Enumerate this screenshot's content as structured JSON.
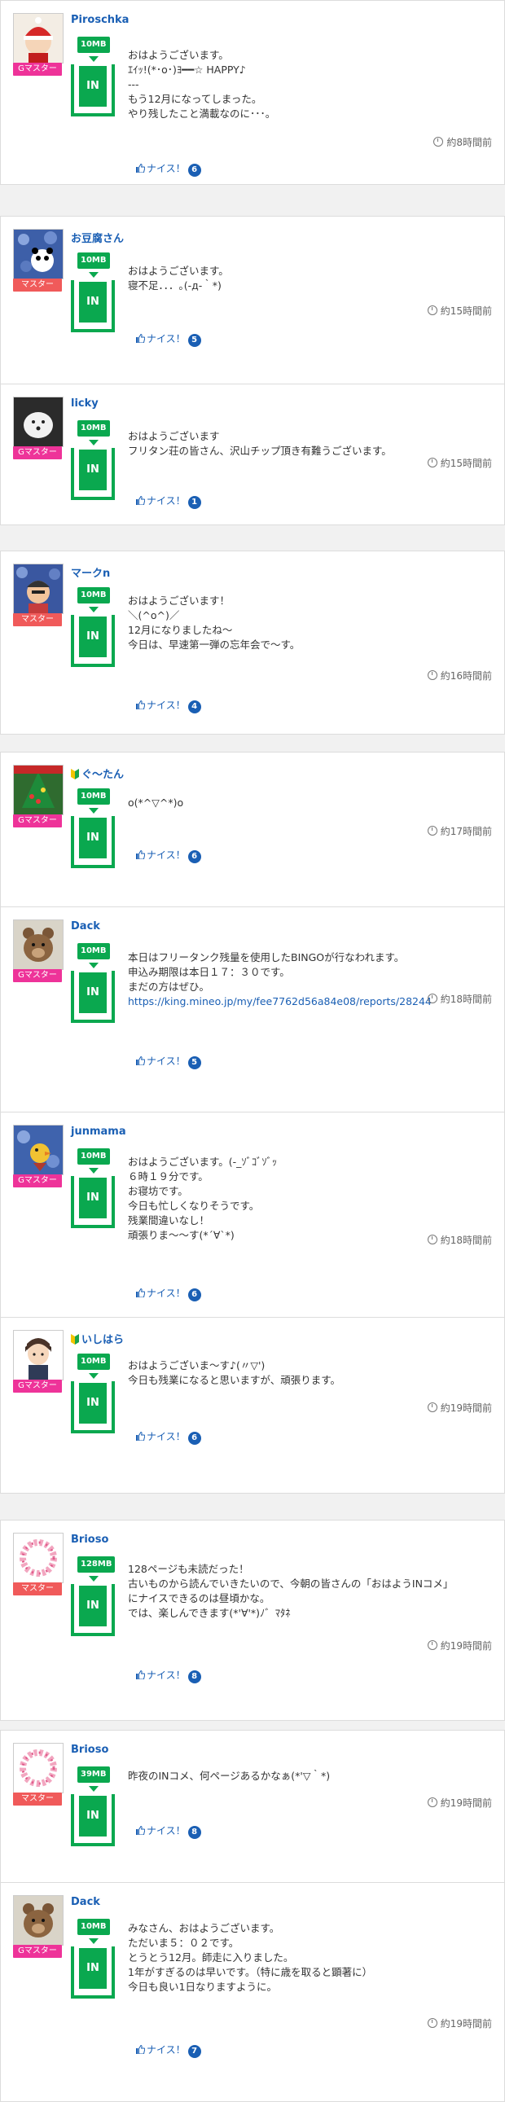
{
  "labels": {
    "like": "ナイス！",
    "in": "IN"
  },
  "posts": [
    {
      "user": "Piroschka",
      "rank": "Gマスター",
      "rank_color": "#ee3399",
      "data": "10MB",
      "beginner": false,
      "lines": [
        "おはようございます。",
        "ｴｲｯ!(*･o･)ﾖ━━☆ HAPPY♪",
        "---",
        "もう12月になってしまった。",
        "やり残したこと満載なのに･･･。"
      ],
      "time": "約8時間前",
      "likes": "6",
      "avatar": "santa-girl"
    },
    {
      "user": "お豆腐さん",
      "rank": "マスター",
      "rank_color": "#f05a5a",
      "data": "10MB",
      "beginner": false,
      "lines": [
        "おはようございます。",
        "寝不足．．．｡(-д-｀*)"
      ],
      "time": "約15時間前",
      "likes": "5",
      "avatar": "flowers-panda"
    },
    {
      "user": "licky",
      "rank": "Gマスター",
      "rank_color": "#ee3399",
      "data": "10MB",
      "beginner": false,
      "lines": [
        "おはようございます",
        "フリタン荘の皆さん、沢山チップ頂き有難うございます。"
      ],
      "time": "約15時間前",
      "likes": "1",
      "avatar": "white-dog"
    },
    {
      "user": "マークn",
      "rank": "マスター",
      "rank_color": "#f05a5a",
      "data": "10MB",
      "beginner": false,
      "lines": [
        "おはようございます！",
        "＼(^o^)／",
        "12月になりましたね〜",
        "今日は、早速第一弾の忘年会で〜す。"
      ],
      "time": "約16時間前",
      "likes": "4",
      "avatar": "flowers-man"
    },
    {
      "user": "ぐ〜たん",
      "rank": "Gマスター",
      "rank_color": "#ee3399",
      "data": "10MB",
      "beginner": true,
      "lines": [
        "o(*^▽^*)o"
      ],
      "time": "約17時間前",
      "likes": "6",
      "avatar": "christmas"
    },
    {
      "user": "Dack",
      "rank": "Gマスター",
      "rank_color": "#ee3399",
      "data": "10MB",
      "beginner": false,
      "lines": [
        "本日はフリータンク残量を使用したBINGOが行なわれます。",
        "申込み期限は本日１７：３０です。",
        "まだの方はぜひ。",
        "https://king.mineo.jp/my/fee7762d56a84e08/reports/28244"
      ],
      "time": "約18時間前",
      "likes": "5",
      "avatar": "bear"
    },
    {
      "user": "junmama",
      "rank": "Gマスター",
      "rank_color": "#ee3399",
      "data": "10MB",
      "beginner": false,
      "lines": [
        "おはようございます。(-_ｿﾞｺﾞｿﾞｯ",
        "６時１９分です。",
        "お寝坊です。",
        "今日も忙しくなりそうです。",
        "残業間違いなし！",
        "頑張りま〜〜す(*´∀`*)"
      ],
      "time": "約18時間前",
      "likes": "6",
      "avatar": "flowers-bird"
    },
    {
      "user": "いしはら",
      "rank": "Gマスター",
      "rank_color": "#ee3399",
      "data": "10MB",
      "beginner": true,
      "lines": [
        "おはようございま〜す♪(〃▽')",
        "今日も残業になると思いますが、頑張ります。"
      ],
      "time": "約19時間前",
      "likes": "6",
      "avatar": "anime-boy"
    },
    {
      "user": "Brioso",
      "rank": "マスター",
      "rank_color": "#f05a5a",
      "data": "128MB",
      "beginner": false,
      "lines": [
        "128ページも未読だった！",
        "古いものから読んでいきたいので、今朝の皆さんの「おはようINコメ」",
        "にナイスできるのは昼頃かな。",
        "では、楽しんできます(*'∀'*)ﾉ゛ﾏﾀﾈ"
      ],
      "time": "約19時間前",
      "likes": "8",
      "avatar": "wreath"
    },
    {
      "user": "Brioso",
      "rank": "マスター",
      "rank_color": "#f05a5a",
      "data": "39MB",
      "beginner": false,
      "lines": [
        "昨夜のINコメ、何ページあるかなぁ(*'▽｀*)"
      ],
      "time": "約19時間前",
      "likes": "8",
      "avatar": "wreath"
    },
    {
      "user": "Dack",
      "rank": "Gマスター",
      "rank_color": "#ee3399",
      "data": "10MB",
      "beginner": false,
      "lines": [
        "みなさん、おはようございます。",
        "ただいま５：０２です。",
        "とうとう12月。師走に入りました。",
        "1年がすぎるのは早いです。（特に歳を取ると顕著に）",
        "今日も良い1日なりますように。"
      ],
      "time": "約19時間前",
      "likes": "7",
      "avatar": "bear"
    }
  ]
}
